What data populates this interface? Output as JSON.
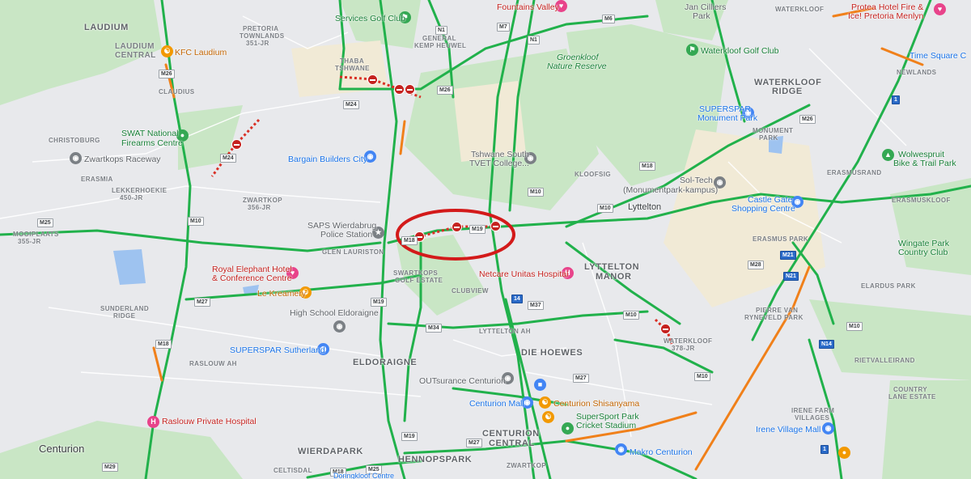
{
  "map": {
    "region": "Centurion",
    "labels": {
      "laudium": "LAUDIUM",
      "laudium_central_1": "LAUDIUM",
      "laudium_central_2": "CENTRAL",
      "kfc": "KFC Laudium",
      "claudius": "CLAUDIUS",
      "swat_1": "SWAT National",
      "swat_2": "Firearms Centre",
      "christoburg": "CHRISTOBURG",
      "zwartkops_raceway": "Zwartkops Raceway",
      "erasmia": "ERASMIA",
      "lekkerhoekie_1": "LEKKERHOEKIE",
      "lekkerhoekie_2": "450-JR",
      "mooiplaats_1": "MOOIPLAATS",
      "mooiplaats_2": "355-JR",
      "pretoria_townlands_1": "PRETORIA",
      "pretoria_townlands_2": "TOWNLANDS",
      "pretoria_townlands_3": "351-JR",
      "thaba_tshwane_1": "THABA",
      "thaba_tshwane_2": "TSHWANE",
      "services_golf": "Services Golf Club",
      "general_kemp_1": "GENERAL",
      "general_kemp_2": "KEMP HEUWEL",
      "fountains_valley": "Fountains Valley",
      "groenkloof_1": "Groenkloof",
      "groenkloof_2": "Nature Reserve",
      "jan_cilliers_1": "Jan Cilliers",
      "jan_cilliers_2": "Park",
      "waterkloof_top": "WATERKLOOF",
      "protea_1": "Protea Hotel Fire &",
      "protea_2": "Ice! Pretoria Menlyn",
      "time_square": "Time Square C",
      "newlands": "NEWLANDS",
      "waterkloof_golf": "Waterkloof Golf Club",
      "waterkloof_ridge_1": "WATERKLOOF",
      "waterkloof_ridge_2": "RIDGE",
      "superspar_monument_1": "SUPERSPAR",
      "superspar_monument_2": "Monument Park",
      "monument_park_1": "MONUMENT",
      "monument_park_2": "PARK",
      "wolwespruit_1": "Wolwespruit",
      "wolwespruit_2": "Bike & Trail Park",
      "erasmusrand": "ERASMUSRAND",
      "erasmuskloof": "ERASMUSKLOOF",
      "bargain_builders": "Bargain Builders City",
      "tshwane_south_1": "Tshwane South",
      "tshwane_south_2": "TVET College...",
      "kloofsig": "KLOOFSIG",
      "soltech_1": "Sol-Tech",
      "soltech_2": "(Monumentpark-kampus)",
      "castle_gate_1": "Castle Gate",
      "castle_gate_2": "Shopping Centre",
      "lyttelton": "Lyttelton",
      "zwartkop_1": "ZWARTKOP",
      "zwartkop_2": "356-JR",
      "saps_1": "SAPS Wierdabrug",
      "saps_2": "Police Station",
      "glen_lauriston": "GLEN LAURISTON",
      "erasmus_park": "ERASMUS PARK",
      "wingate_1": "Wingate Park",
      "wingate_2": "Country Club",
      "royal_elephant_1": "Royal Elephant Hotel",
      "royal_elephant_2": "& Conference Centre",
      "swartkops_golf_1": "SWARTKOPS",
      "swartkops_golf_2": "GOLF ESTATE",
      "netcare": "Netcare Unitas Hospital",
      "lyttelton_manor_1": "LYTTELTON",
      "lyttelton_manor_2": "MANOR",
      "le_kreamery": "Le Kreamery",
      "clubview": "CLUBVIEW",
      "elardus_park": "ELARDUS PARK",
      "sunderland_1": "SUNDERLAND",
      "sunderland_2": "RIDGE",
      "high_school": "High School Eldoraigne",
      "pierre_1": "PIERRE VAN",
      "pierre_2": "RYNEVELD PARK",
      "lyttelton_ah": "LYTTELTON AH",
      "waterkloof_378_1": "WATERKLOOF",
      "waterkloof_378_2": "378-JR",
      "superspar_sutherland": "SUPERSPAR Sutherland",
      "die_hoewes": "DIE HOEWES",
      "rietvalleirand": "RIETVALLEIRAND",
      "eldoraigne": "ELDORAIGNE",
      "raslouw_ah": "RASLOUW AH",
      "outsurance": "OUTsurance Centurion",
      "country_lane_1": "COUNTRY",
      "country_lane_2": "LANE ESTATE",
      "centurion_mall": "Centurion Mall",
      "centurion_shisanyama": "Centurion Shisanyama",
      "raslouw_hospital": "Raslouw Private Hospital",
      "supersport_1": "SuperSport Park",
      "supersport_2": "Cricket Stadium",
      "irene_farm_1": "IRENE FARM",
      "irene_farm_2": "VILLAGES",
      "irene_village": "Irene Village Mall",
      "centurion": "Centurion",
      "wierdapark": "WIERDAPARK",
      "centurion_central_1": "CENTURION",
      "centurion_central_2": "CENTRAL",
      "celtisdal": "CELTISDAL",
      "makro": "Makro Centurion",
      "hennopspark": "HENNOPSPARK",
      "zwartkop_bottom": "ZWARTKOP",
      "cut_bottom": "Doringkloof Centre"
    },
    "route_shields": [
      "M26",
      "N1",
      "M7",
      "N1",
      "M24",
      "M26",
      "M18",
      "M25",
      "M10",
      "M18",
      "M10",
      "M19",
      "M24",
      "M10",
      "M21",
      "M26",
      "M28",
      "M27",
      "M18",
      "M34",
      "M37",
      "M10",
      "M27",
      "N14",
      "M19",
      "M19",
      "M25",
      "M18",
      "M10",
      "M27",
      "M29",
      "14",
      "1",
      "1",
      "N21",
      "M6",
      "M10"
    ],
    "icons": [
      "restaurant-icon",
      "golf-icon",
      "shopping-icon",
      "hospital-icon",
      "police-icon",
      "transit-icon",
      "museum-icon",
      "school-icon"
    ],
    "colors": {
      "traffic_free": "#21b14b",
      "traffic_slow": "#f0801a",
      "traffic_jam": "#d93025",
      "highlight": "#d31a1a",
      "park": "#c9e6c5",
      "water": "#9ec3f0",
      "land": "#e8e9ec"
    }
  }
}
